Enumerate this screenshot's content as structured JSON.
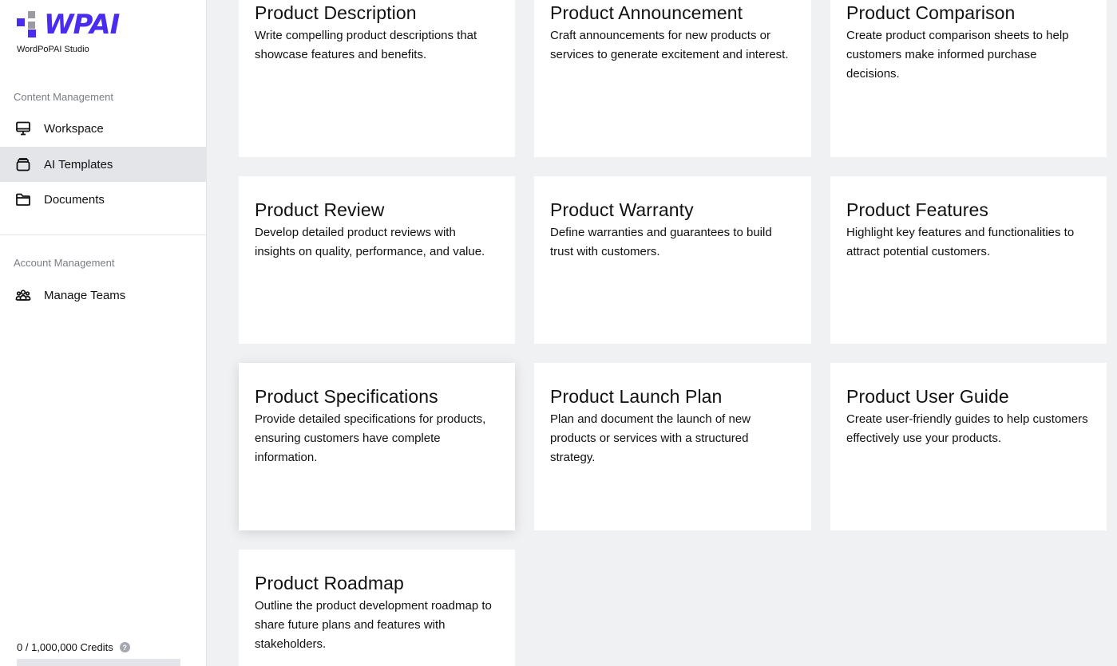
{
  "brand": {
    "name": "WPAI",
    "subtitle": "WordPoPAI Studio",
    "primary_color": "#4a2cf0",
    "secondary_color": "#9a9ba1"
  },
  "sidebar": {
    "content_section_label": "Content Management",
    "account_section_label": "Account Management",
    "items": [
      {
        "label": "Workspace",
        "icon": "monitor-icon",
        "active": false
      },
      {
        "label": "AI Templates",
        "icon": "layers-icon",
        "active": true
      },
      {
        "label": "Documents",
        "icon": "folder-icon",
        "active": false
      },
      {
        "label": "Manage Teams",
        "icon": "users-icon",
        "active": false
      }
    ],
    "credits_text": "0 / 1,000,000 Credits",
    "credits_used_fraction": 0,
    "help_glyph": "?"
  },
  "templates": [
    {
      "title": "Product Description",
      "description": "Write compelling product descriptions that showcase features and benefits."
    },
    {
      "title": "Product Announcement",
      "description": "Craft announcements for new products or services to generate excitement and interest."
    },
    {
      "title": "Product Comparison",
      "description": "Create product comparison sheets to help customers make informed purchase decisions."
    },
    {
      "title": "Product Review",
      "description": "Develop detailed product reviews with insights on quality, performance, and value."
    },
    {
      "title": "Product Warranty",
      "description": "Define warranties and guarantees to build trust with customers."
    },
    {
      "title": "Product Features",
      "description": "Highlight key features and functionalities to attract potential customers."
    },
    {
      "title": "Product Specifications",
      "description": "Provide detailed specifications for products, ensuring customers have complete information."
    },
    {
      "title": "Product Launch Plan",
      "description": "Plan and document the launch of new products or services with a structured strategy."
    },
    {
      "title": "Product User Guide",
      "description": "Create user-friendly guides to help customers effectively use your products."
    },
    {
      "title": "Product Roadmap",
      "description": "Outline the product development roadmap to share future plans and features with stakeholders."
    }
  ]
}
